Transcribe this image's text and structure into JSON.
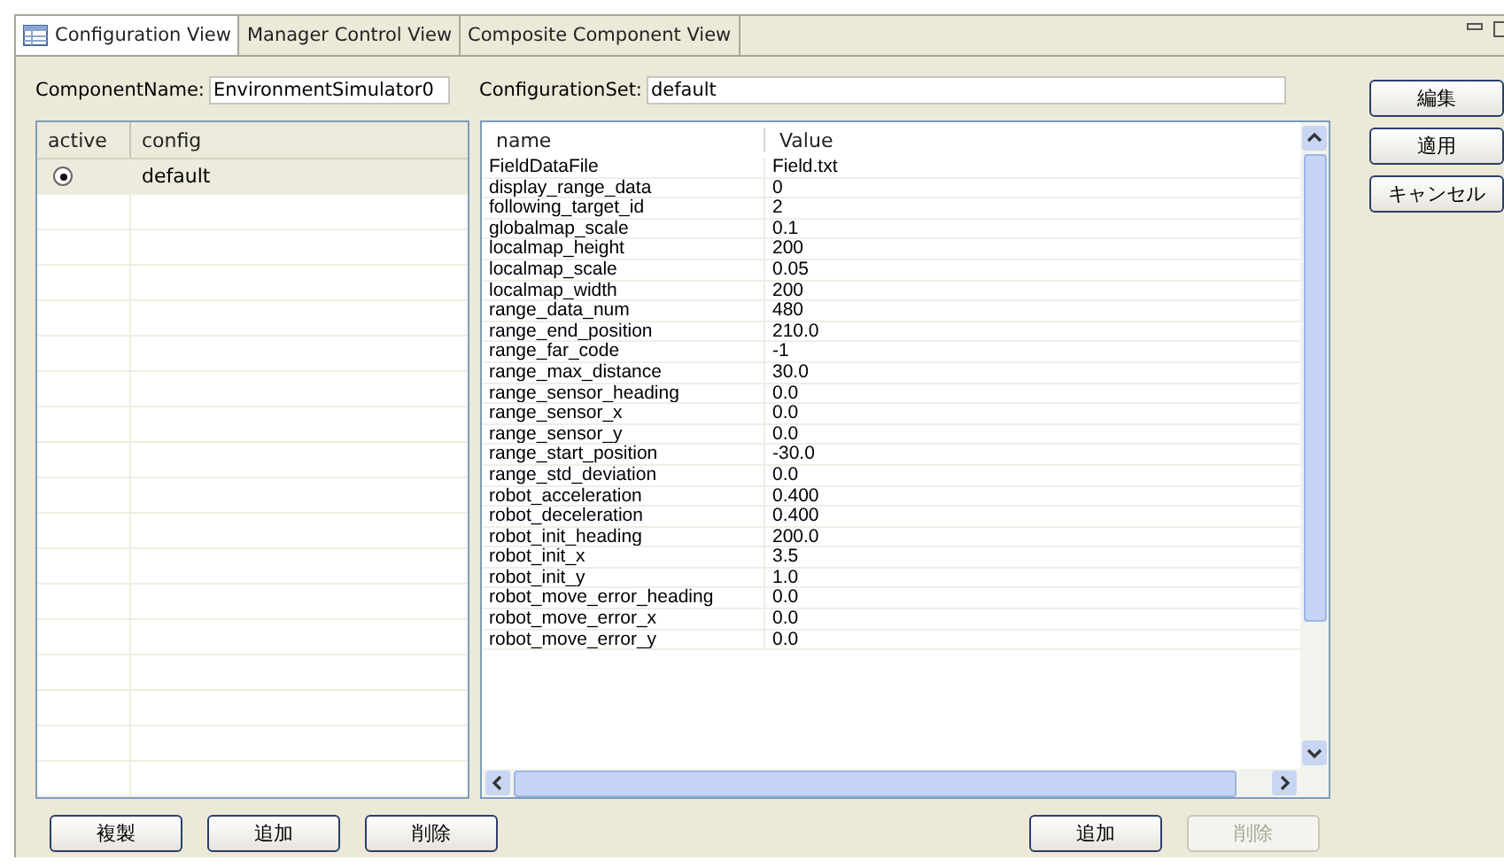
{
  "tabs": [
    {
      "label": "Configuration View",
      "selected": true
    },
    {
      "label": "Manager Control View",
      "selected": false
    },
    {
      "label": "Composite Component View",
      "selected": false
    }
  ],
  "component_name": {
    "label": "ComponentName:",
    "value": "EnvironmentSimulator0"
  },
  "configuration_set": {
    "label": "ConfigurationSet:",
    "value": "default"
  },
  "config_table": {
    "columns": [
      "active",
      "config"
    ],
    "rows": [
      {
        "name": "default",
        "active": true
      }
    ]
  },
  "param_table": {
    "columns": [
      "name",
      "Value"
    ],
    "rows": [
      {
        "name": "FieldDataFile",
        "value": "Field.txt"
      },
      {
        "name": "display_range_data",
        "value": "0"
      },
      {
        "name": "following_target_id",
        "value": "2"
      },
      {
        "name": "globalmap_scale",
        "value": "0.1"
      },
      {
        "name": "localmap_height",
        "value": "200"
      },
      {
        "name": "localmap_scale",
        "value": "0.05"
      },
      {
        "name": "localmap_width",
        "value": "200"
      },
      {
        "name": "range_data_num",
        "value": "480"
      },
      {
        "name": "range_end_position",
        "value": "210.0"
      },
      {
        "name": "range_far_code",
        "value": "-1"
      },
      {
        "name": "range_max_distance",
        "value": "30.0"
      },
      {
        "name": "range_sensor_heading",
        "value": "0.0"
      },
      {
        "name": "range_sensor_x",
        "value": "0.0"
      },
      {
        "name": "range_sensor_y",
        "value": "0.0"
      },
      {
        "name": "range_start_position",
        "value": "-30.0"
      },
      {
        "name": "range_std_deviation",
        "value": "0.0"
      },
      {
        "name": "robot_acceleration",
        "value": "0.400"
      },
      {
        "name": "robot_deceleration",
        "value": "0.400"
      },
      {
        "name": "robot_init_heading",
        "value": "200.0"
      },
      {
        "name": "robot_init_x",
        "value": "3.5"
      },
      {
        "name": "robot_init_y",
        "value": "1.0"
      },
      {
        "name": "robot_move_error_heading",
        "value": "0.0"
      },
      {
        "name": "robot_move_error_x",
        "value": "0.0"
      },
      {
        "name": "robot_move_error_y",
        "value": "0.0"
      }
    ]
  },
  "side_buttons": [
    {
      "label": "編集",
      "disabled": false
    },
    {
      "label": "適用",
      "disabled": false
    },
    {
      "label": "キャンセル",
      "disabled": false
    }
  ],
  "left_buttons": [
    {
      "label": "複製",
      "disabled": false
    },
    {
      "label": "追加",
      "disabled": false
    },
    {
      "label": "削除",
      "disabled": false
    }
  ],
  "right_buttons": [
    {
      "label": "追加",
      "disabled": false
    },
    {
      "label": "削除",
      "disabled": true
    }
  ]
}
